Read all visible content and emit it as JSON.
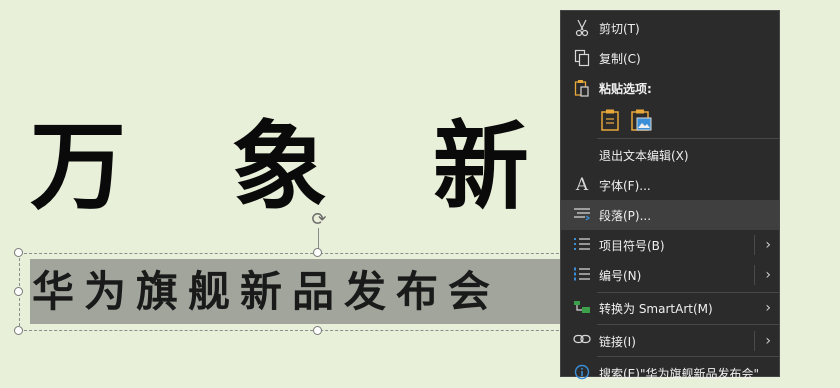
{
  "slide": {
    "title": "万 象 新 生",
    "subtitle": "华为旗舰新品发布会"
  },
  "context_menu": {
    "items": [
      {
        "label": "剪切(T)",
        "icon": "scissors-icon"
      },
      {
        "label": "复制(C)",
        "icon": "copy-icon"
      },
      {
        "label": "粘贴选项:",
        "icon": "clipboard-icon"
      },
      {
        "label": "退出文本编辑(X)",
        "icon": ""
      },
      {
        "label": "字体(F)...",
        "icon": "font-icon"
      },
      {
        "label": "段落(P)...",
        "icon": "paragraph-icon"
      },
      {
        "label": "项目符号(B)",
        "icon": "bullets-icon"
      },
      {
        "label": "编号(N)",
        "icon": "numbering-icon"
      },
      {
        "label": "转换为 SmartArt(M)",
        "icon": "smartart-icon"
      },
      {
        "label": "链接(I)",
        "icon": "link-icon"
      },
      {
        "label": "搜索(E)\"华为旗舰新品发布会\"",
        "icon": "search-info-icon"
      }
    ],
    "paste_options": [
      "keep-source-formatting-icon",
      "picture-paste-icon"
    ]
  },
  "colors": {
    "slide_bg": "#e8f0d9",
    "menu_bg": "#2b2b2b",
    "subtitle_bg": "#a1a59c",
    "accent_gold": "#e8a83a",
    "accent_blue": "#3a8fd8",
    "accent_green": "#3aa04a"
  }
}
